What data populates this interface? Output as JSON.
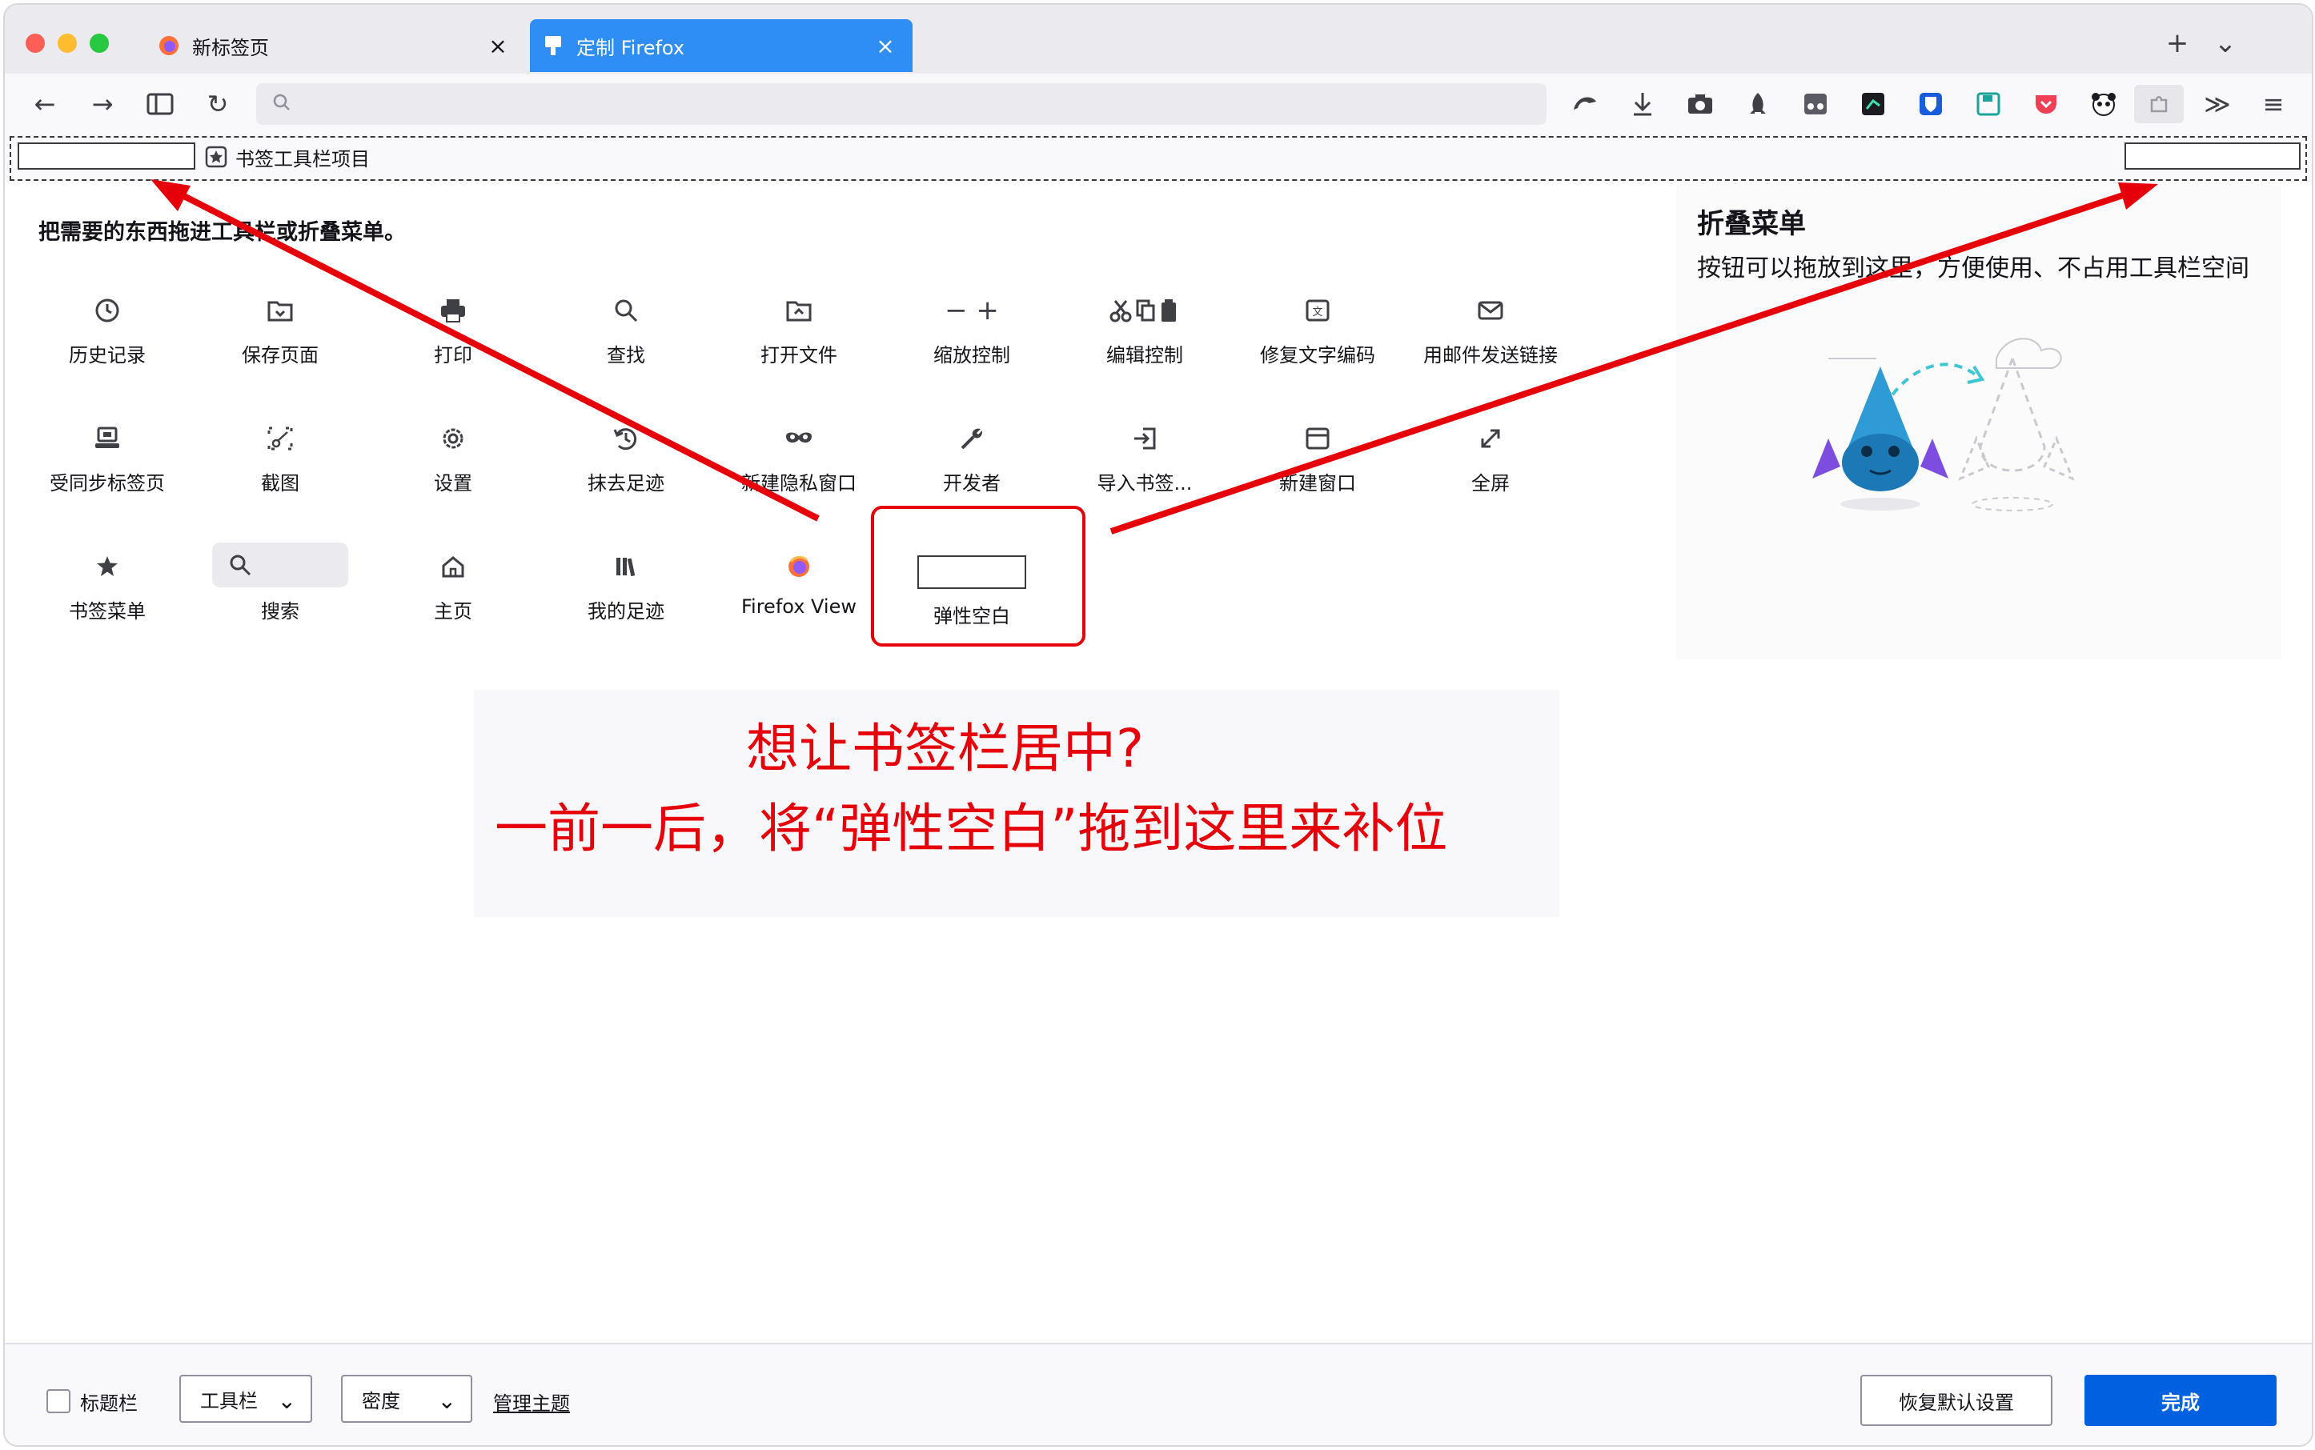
{
  "tabs": [
    {
      "title": "新标签页",
      "close": "×",
      "icon": "firefox-logo"
    },
    {
      "title": "定制 Firefox",
      "close": "×",
      "icon": "customize-icon"
    }
  ],
  "tabstrip": {
    "new_tab": "+",
    "list_tabs": "⌄"
  },
  "nav": {
    "back": "←",
    "forward": "→",
    "reload": "↻",
    "overflow": "≫",
    "menu": "≡",
    "url_placeholder": ""
  },
  "bookmarks_toolbar": {
    "item_label": "书签工具栏项目"
  },
  "palette": {
    "instruction": "把需要的东西拖进工具栏或折叠菜单。",
    "items": [
      {
        "label": "历史记录",
        "icon": "history-icon"
      },
      {
        "label": "保存页面",
        "icon": "save-page-icon"
      },
      {
        "label": "打印",
        "icon": "print-icon"
      },
      {
        "label": "查找",
        "icon": "find-icon"
      },
      {
        "label": "打开文件",
        "icon": "open-file-icon"
      },
      {
        "label": "缩放控制",
        "icon": "zoom-controls-icon",
        "glyph": "− +"
      },
      {
        "label": "编辑控制",
        "icon": "edit-controls-icon"
      },
      {
        "label": "修复文字编码",
        "icon": "text-encoding-icon"
      },
      {
        "label": "用邮件发送链接",
        "icon": "email-link-icon"
      },
      {
        "label": "受同步标签页",
        "icon": "synced-tabs-icon"
      },
      {
        "label": "截图",
        "icon": "screenshot-icon"
      },
      {
        "label": "设置",
        "icon": "settings-icon"
      },
      {
        "label": "抹去足迹",
        "icon": "forget-icon"
      },
      {
        "label": "新建隐私窗口",
        "icon": "private-window-icon"
      },
      {
        "label": "开发者",
        "icon": "developer-icon"
      },
      {
        "label": "导入书签...",
        "icon": "import-bookmarks-icon"
      },
      {
        "label": "新建窗口",
        "icon": "new-window-icon"
      },
      {
        "label": "全屏",
        "icon": "fullscreen-icon"
      },
      {
        "label": "书签菜单",
        "icon": "bookmarks-menu-icon"
      },
      {
        "label": "搜索",
        "icon": "search-icon"
      },
      {
        "label": "主页",
        "icon": "home-icon"
      },
      {
        "label": "我的足迹",
        "icon": "library-icon"
      },
      {
        "label": "Firefox View",
        "icon": "firefox-view-icon"
      },
      {
        "label": "弹性空白",
        "icon": "flexible-space"
      }
    ]
  },
  "overflow_menu": {
    "title": "折叠菜单",
    "description": "按钮可以拖放到这里，方便使用、不占用工具栏空间"
  },
  "annotation": {
    "line1": "想让书签栏居中?",
    "line2": "一前一后，将“弹性空白”拖到这里来补位",
    "color": "#e5000a"
  },
  "footer": {
    "title_bar_label": "标题栏",
    "toolbars_label": "工具栏",
    "density_label": "密度",
    "manage_themes": "管理主题",
    "restore_defaults": "恢复默认设置",
    "done": "完成"
  },
  "colors": {
    "accent": "#2f8ef4",
    "done_button": "#0061e0",
    "annotation_red": "#e5000a"
  }
}
